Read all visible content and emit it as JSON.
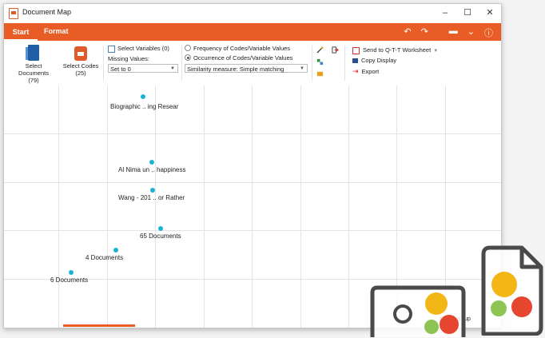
{
  "window": {
    "title": "Document Map",
    "minimize": "–",
    "maximize": "☐",
    "close": "✕"
  },
  "ribbon_tabs": {
    "start": "Start",
    "format": "Format"
  },
  "ribbon": {
    "select_documents": {
      "label": "Select Documents",
      "count": "(79)"
    },
    "select_codes": {
      "label": "Select Codes",
      "count": "(25)"
    },
    "select_variables": "Select Variables (0)",
    "missing_values_label": "Missing Values:",
    "missing_values_value": "Set to 0",
    "frequency_option": "Frequency of Codes/Variable Values",
    "occurrence_option": "Occurrence of Codes/Variable Values",
    "similarity_measure": "Similarity measure: Simple matching",
    "send_qtt": "Send to Q-T-T Worksheet",
    "copy_display": "Copy Display",
    "export": "Export"
  },
  "map_points": [
    {
      "label": "Biographic .. ing Resear"
    },
    {
      "label": "Al Nima un .. happiness"
    },
    {
      "label": "Wang - 201 .. or Rather"
    },
    {
      "label": "65 Documents"
    },
    {
      "label": "4 Documents"
    },
    {
      "label": "6 Documents"
    },
    {
      "label": "Focus group"
    }
  ],
  "colors": {
    "accent": "#e85d26",
    "point": "#19b4d3"
  }
}
